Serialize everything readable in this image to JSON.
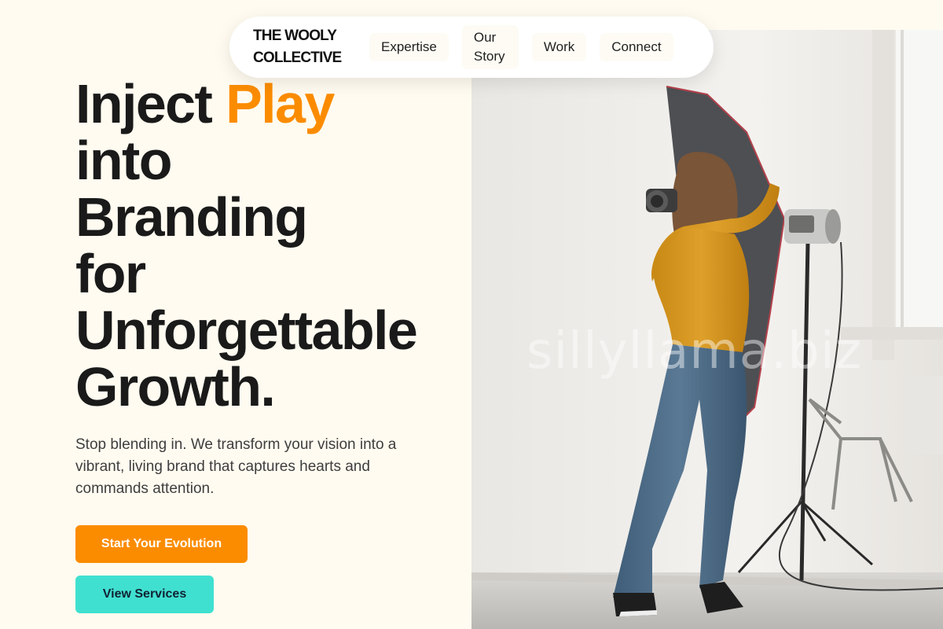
{
  "nav": {
    "brand": "THE WOOLY COLLECTIVE",
    "links": [
      "Expertise",
      "Our Story",
      "Work",
      "Connect"
    ]
  },
  "hero": {
    "headline_line1_a": "Inject",
    "headline_line1_accent": "Play",
    "headline_line2": "into",
    "headline_line3": "Branding",
    "headline_line4": "for",
    "headline_line5": "Unforgettable",
    "headline_line6": "Growth.",
    "subtext": "Stop blending in. We transform your vision into a vibrant, living brand that captures hearts and commands attention.",
    "primary_cta": "Start Your Evolution",
    "secondary_cta": "View Services",
    "watermark": "sillyllama.biz"
  },
  "colors": {
    "background": "#fffbf0",
    "accent": "#fb8c00",
    "secondary": "#40e0d0",
    "text": "#1a1a1a"
  }
}
